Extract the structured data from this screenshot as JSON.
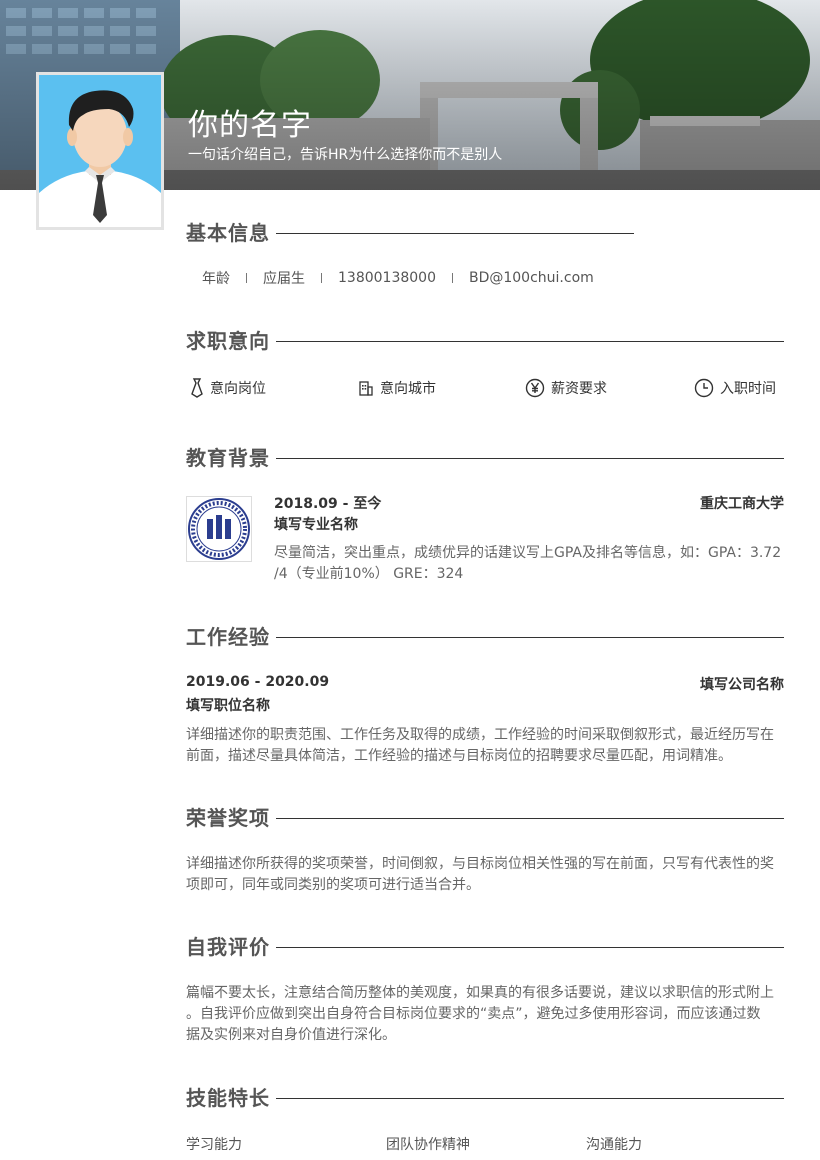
{
  "header": {
    "name": "你的名字",
    "intro": "一句话介绍自己，告诉HR为什么选择你而不是别人"
  },
  "sections": {
    "basic": {
      "title": "基本信息"
    },
    "intent": {
      "title": "求职意向"
    },
    "education": {
      "title": "教育背景"
    },
    "work": {
      "title": "工作经验"
    },
    "honors": {
      "title": "荣誉奖项"
    },
    "self": {
      "title": "自我评价"
    },
    "skills": {
      "title": "技能特长"
    }
  },
  "basic_info": {
    "age": "年龄",
    "status": "应届生",
    "phone": "13800138000",
    "email": "BD@100chui.com"
  },
  "intent": {
    "position": "意向岗位",
    "city": "意向城市",
    "salary": "薪资要求",
    "entry_time": "入职时间"
  },
  "education": {
    "period": "2018.09 - 至今",
    "school": "重庆工商大学",
    "major": "填写专业名称",
    "desc_line1": "尽量简洁，突出重点，成绩优异的话建议写上GPA及排名等信息，如：GPA：3.72",
    "desc_line2": "/4（专业前10%） GRE：324"
  },
  "work": {
    "period": "2019.06 - 2020.09",
    "company": "填写公司名称",
    "position": "填写职位名称",
    "desc_line1": "详细描述你的职责范围、工作任务及取得的成绩，工作经验的时间采取倒叙形式，最近经历写在",
    "desc_line2": "前面，描述尽量具体简洁，工作经验的描述与目标岗位的招聘要求尽量匹配，用词精准。"
  },
  "honors": {
    "desc_line1": "详细描述你所获得的奖项荣誉，时间倒叙，与目标岗位相关性强的写在前面，只写有代表性的奖",
    "desc_line2": "项即可，同年或同类别的奖项可进行适当合并。"
  },
  "self_eval": {
    "desc_line1": "篇幅不要太长，注意结合简历整体的美观度，如果真的有很多话要说，建议以求职信的形式附上",
    "desc_line2": "。自我评价应做到突出自身符合目标岗位要求的“卖点”，避免过多使用形容词，而应该通过数",
    "desc_line3": "据及实例来对自身价值进行深化。"
  },
  "skills": {
    "items": [
      "学习能力",
      "团队协作精神",
      "沟通能力"
    ]
  },
  "colors": {
    "avatar_bg": "#5bc0f0",
    "title_gray": "#555555",
    "line": "#333333"
  },
  "icons": {
    "position": "tie-icon",
    "city": "building-icon",
    "salary": "yen-icon",
    "entry_time": "clock-icon",
    "school_logo": "university-logo"
  }
}
